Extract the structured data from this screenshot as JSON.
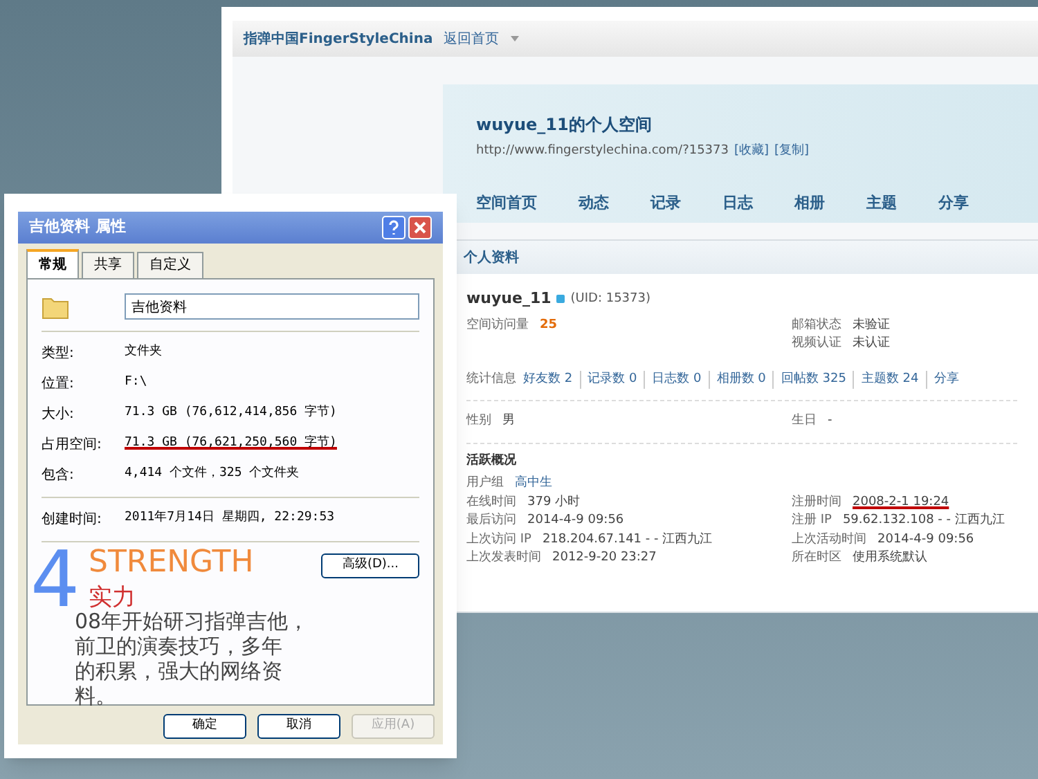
{
  "web_page": {
    "brand": "指弹中国FingerStyleChina",
    "home_link": "返回首页",
    "space_title": "wuyue_11的个人空间",
    "url": "http://www.fingerstylechina.com/?15373",
    "url_actions": [
      "[收藏]",
      "[复制]"
    ],
    "nav": [
      "空间首页",
      "动态",
      "记录",
      "日志",
      "相册",
      "主题",
      "分享"
    ],
    "section_title": "个人资料",
    "username": "wuyue_11",
    "uid": "(UID: 15373)",
    "visits": {
      "label": "空间访问量",
      "value": "25"
    },
    "verification": [
      {
        "label": "邮箱状态",
        "value": "未验证"
      },
      {
        "label": "视频认证",
        "value": "未认证"
      }
    ],
    "stats_label": "统计信息",
    "stats": [
      "好友数 2",
      "记录数 0",
      "日志数 0",
      "相册数 0",
      "回帖数 325",
      "主题数 24",
      "分享"
    ],
    "gender": {
      "label": "性别",
      "value": "男"
    },
    "birthday": {
      "label": "生日",
      "value": "-"
    },
    "activity_title": "活跃概况",
    "user_group": {
      "label": "用户组",
      "value": "高中生"
    },
    "activity_left": [
      {
        "label": "在线时间",
        "value": "379 小时"
      },
      {
        "label": "最后访问",
        "value": "2014-4-9 09:56"
      },
      {
        "label": "上次访问 IP",
        "value": "218.204.67.141 - - 江西九江"
      },
      {
        "label": "上次发表时间",
        "value": "2012-9-20 23:27"
      }
    ],
    "activity_right": [
      {
        "label": "注册时间",
        "value": "2008-2-1 19:24",
        "underlined": true
      },
      {
        "label": "注册 IP",
        "value": "59.62.132.108 - - 江西九江",
        "underlined": false
      },
      {
        "label": "上次活动时间",
        "value": "2014-4-9 09:56",
        "underlined": false
      },
      {
        "label": "所在时区",
        "value": "使用系统默认",
        "underlined": false
      }
    ]
  },
  "dialog": {
    "title": "吉他资料 属性",
    "tabs": [
      {
        "label": "常规",
        "selected": true
      },
      {
        "label": "共享",
        "selected": false
      },
      {
        "label": "自定义",
        "selected": false
      }
    ],
    "name_value": "吉他资料",
    "props": [
      {
        "label": "类型:",
        "value": "文件夹",
        "underlined": false
      },
      {
        "label": "位置:",
        "value": "F:\\",
        "underlined": false
      },
      {
        "label": "大小:",
        "value": "71.3 GB (76,612,414,856 字节)",
        "underlined": false
      },
      {
        "label": "占用空间:",
        "value": "71.3 GB (76,621,250,560 字节)",
        "underlined": true
      },
      {
        "label": "包含:",
        "value": "4,414 个文件，325 个文件夹",
        "underlined": false
      },
      {
        "label": "创建时间:",
        "value": "2011年7月14日 星期四, 22:29:53",
        "underlined": false
      }
    ],
    "advanced_button": "高级(D)...",
    "buttons": [
      {
        "label": "确定",
        "disabled": false
      },
      {
        "label": "取消",
        "disabled": false
      },
      {
        "label": "应用(A)",
        "disabled": true
      }
    ]
  },
  "overlay": {
    "number": "4",
    "heading": "STRENGTH",
    "subheading": "实力",
    "lines": [
      "08年开始研习指弹吉他，",
      "前卫的演奏技巧，多年",
      "的积累，强大的网络资",
      "料。"
    ]
  }
}
